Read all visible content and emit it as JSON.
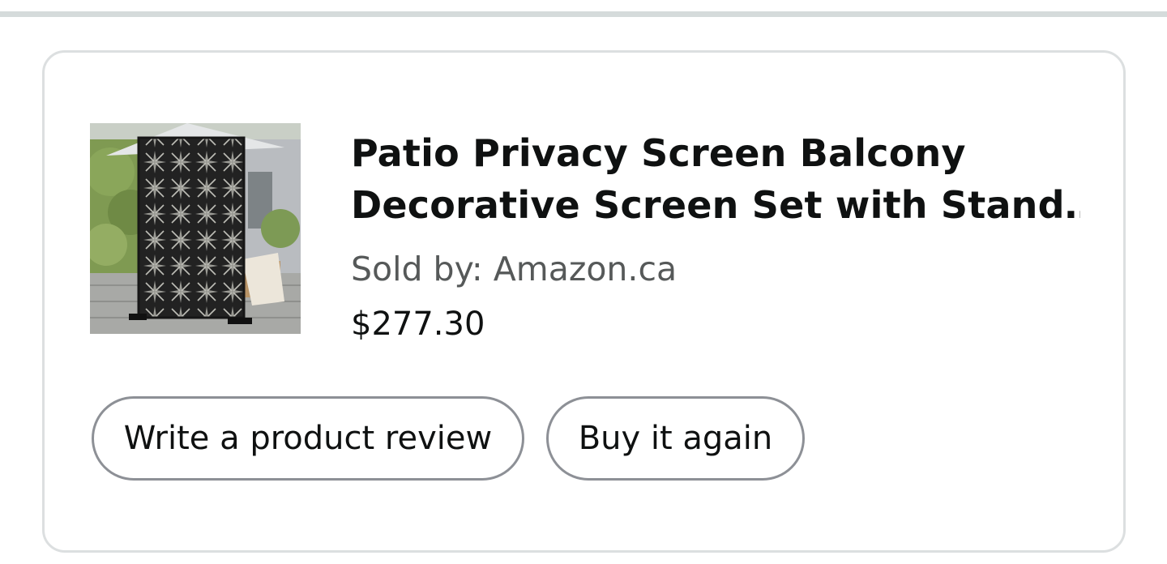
{
  "order_item": {
    "image_alt": "Patio privacy screen product photo",
    "title_line1": "Patio Privacy Screen Balcony",
    "title_line2": "Decorative Screen Set with Stand…",
    "seller": "Sold by: Amazon.ca",
    "price": "$277.30"
  },
  "actions": {
    "review_label": "Write a product review",
    "buy_again_label": "Buy it again"
  },
  "colors": {
    "text_primary": "#0f1111",
    "text_secondary": "#565959",
    "border": "#dcdfe0",
    "button_border": "#8d9096",
    "divider": "#d5dbdb"
  }
}
